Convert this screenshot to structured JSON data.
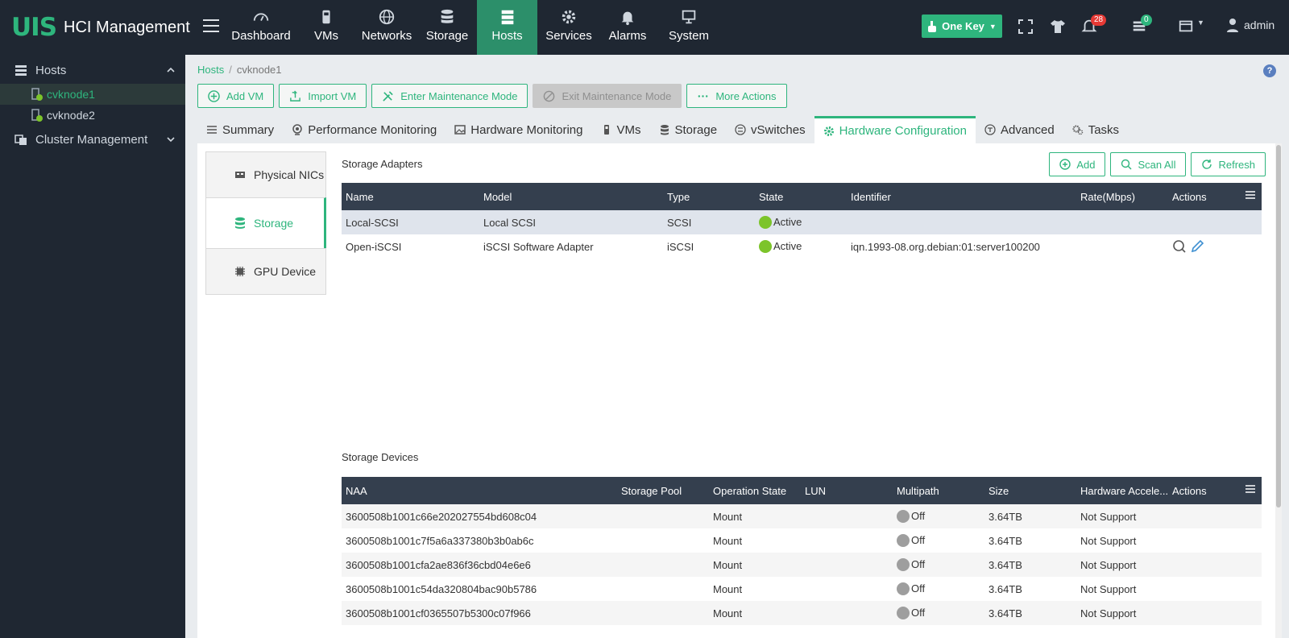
{
  "app": {
    "logo": "UIS",
    "title": "HCI Management"
  },
  "nav": [
    {
      "label": "Dashboard",
      "icon": "gauge-icon"
    },
    {
      "label": "VMs",
      "icon": "vm-icon"
    },
    {
      "label": "Networks",
      "icon": "globe-icon"
    },
    {
      "label": "Storage",
      "icon": "database-icon"
    },
    {
      "label": "Hosts",
      "icon": "server-icon",
      "active": true
    },
    {
      "label": "Services",
      "icon": "gear-icon"
    },
    {
      "label": "Alarms",
      "icon": "bell-icon"
    },
    {
      "label": "System",
      "icon": "monitor-icon"
    }
  ],
  "topright": {
    "one_key": "One Key",
    "alarm_count": "28",
    "task_count": "0",
    "user": "admin"
  },
  "sidebar": {
    "hosts_label": "Hosts",
    "hosts": [
      {
        "label": "cvknode1",
        "active": true
      },
      {
        "label": "cvknode2"
      }
    ],
    "cluster_label": "Cluster Management"
  },
  "breadcrumb": {
    "root": "Hosts",
    "separator": "/",
    "current": "cvknode1"
  },
  "actions": {
    "add_vm": "Add VM",
    "import_vm": "Import VM",
    "enter_maint": "Enter Maintenance Mode",
    "exit_maint": "Exit Maintenance Mode",
    "more": "More Actions"
  },
  "tabs": [
    {
      "label": "Summary"
    },
    {
      "label": "Performance Monitoring"
    },
    {
      "label": "Hardware Monitoring"
    },
    {
      "label": "VMs"
    },
    {
      "label": "Storage"
    },
    {
      "label": "vSwitches"
    },
    {
      "label": "Hardware Configuration",
      "active": true
    },
    {
      "label": "Advanced"
    },
    {
      "label": "Tasks"
    }
  ],
  "subnav": [
    {
      "label": "Physical NICs"
    },
    {
      "label": "Storage",
      "active": true
    },
    {
      "label": "GPU Device"
    }
  ],
  "adapters": {
    "title": "Storage Adapters",
    "buttons": {
      "add": "Add",
      "scan_all": "Scan All",
      "refresh": "Refresh"
    },
    "columns": [
      "Name",
      "Model",
      "Type",
      "State",
      "Identifier",
      "Rate(Mbps)",
      "Actions"
    ],
    "rows": [
      {
        "name": "Local-SCSI",
        "model": "Local SCSI",
        "type": "SCSI",
        "state": "Active",
        "identifier": "",
        "rate": ""
      },
      {
        "name": "Open-iSCSI",
        "model": "iSCSI Software Adapter",
        "type": "iSCSI",
        "state": "Active",
        "identifier": "iqn.1993-08.org.debian:01:server100200",
        "rate": ""
      }
    ]
  },
  "devices": {
    "title": "Storage Devices",
    "columns": [
      "NAA",
      "Storage Pool",
      "Operation State",
      "LUN",
      "Multipath",
      "Size",
      "Hardware Accele...",
      "Actions"
    ],
    "rows": [
      {
        "naa": "3600508b1001c66e202027554bd608c04",
        "pool": "",
        "op": "Mount",
        "lun": "",
        "multipath": "Off",
        "size": "3.64TB",
        "hw": "Not Support"
      },
      {
        "naa": "3600508b1001c7f5a6a337380b3b0ab6c",
        "pool": "",
        "op": "Mount",
        "lun": "",
        "multipath": "Off",
        "size": "3.64TB",
        "hw": "Not Support"
      },
      {
        "naa": "3600508b1001cfa2ae836f36cbd04e6e6",
        "pool": "",
        "op": "Mount",
        "lun": "",
        "multipath": "Off",
        "size": "3.64TB",
        "hw": "Not Support"
      },
      {
        "naa": "3600508b1001c54da320804bac90b5786",
        "pool": "",
        "op": "Mount",
        "lun": "",
        "multipath": "Off",
        "size": "3.64TB",
        "hw": "Not Support"
      },
      {
        "naa": "3600508b1001cf0365507b5300c07f966",
        "pool": "",
        "op": "Mount",
        "lun": "",
        "multipath": "Off",
        "size": "3.64TB",
        "hw": "Not Support"
      }
    ]
  },
  "colors": {
    "accent": "#2eb57d",
    "topbar": "#1f2732",
    "table_header": "#343f4e",
    "active_dot": "#7cc42a"
  }
}
